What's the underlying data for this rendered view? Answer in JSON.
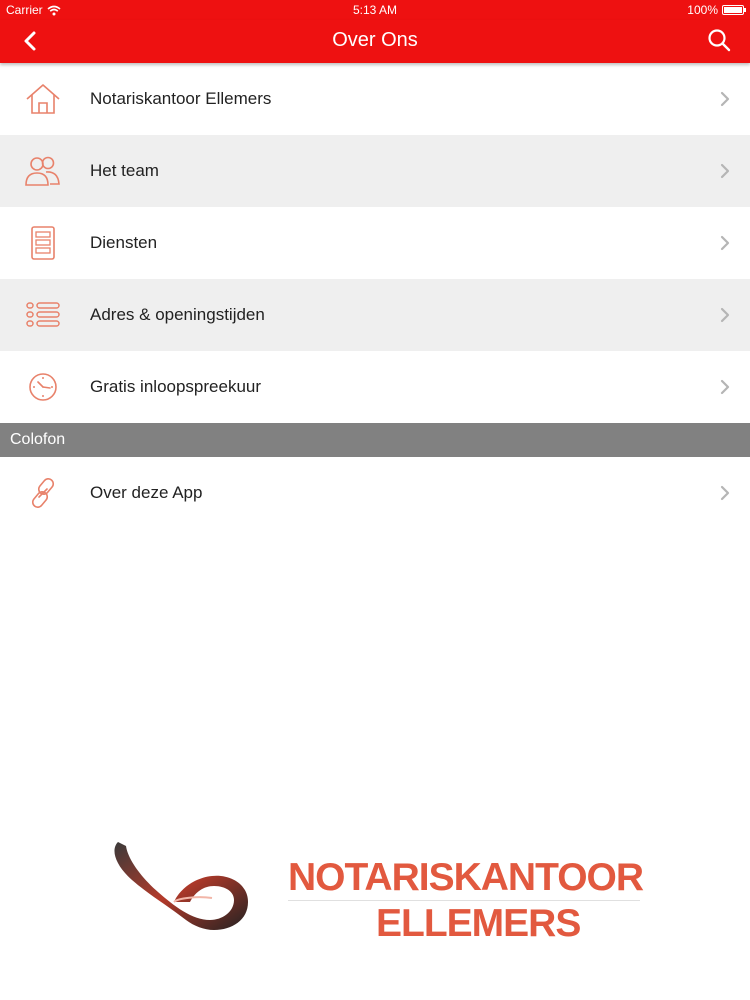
{
  "status_bar": {
    "carrier": "Carrier",
    "time": "5:13 AM",
    "battery": "100%",
    "battery_level": 1.0
  },
  "nav": {
    "title": "Over Ons",
    "back_icon": "chevron-left-icon",
    "search_icon": "search-icon"
  },
  "items": [
    {
      "label": "Notariskantoor Ellemers",
      "icon": "house-icon"
    },
    {
      "label": "Het team",
      "icon": "people-icon"
    },
    {
      "label": "Diensten",
      "icon": "document-icon"
    },
    {
      "label": "Adres & openingstijden",
      "icon": "list-icon"
    },
    {
      "label": "Gratis inloopspreekuur",
      "icon": "clock-icon"
    }
  ],
  "section": {
    "title": "Colofon"
  },
  "colofon_items": [
    {
      "label": "Over deze App",
      "icon": "link-icon"
    }
  ],
  "logo": {
    "line1": "NOTARISKANTOOR",
    "line2": "ELLEMERS"
  },
  "colors": {
    "accent": "#ee1111",
    "icon": "#e8826b",
    "section": "#818181",
    "logo_text": "#e2593f"
  }
}
